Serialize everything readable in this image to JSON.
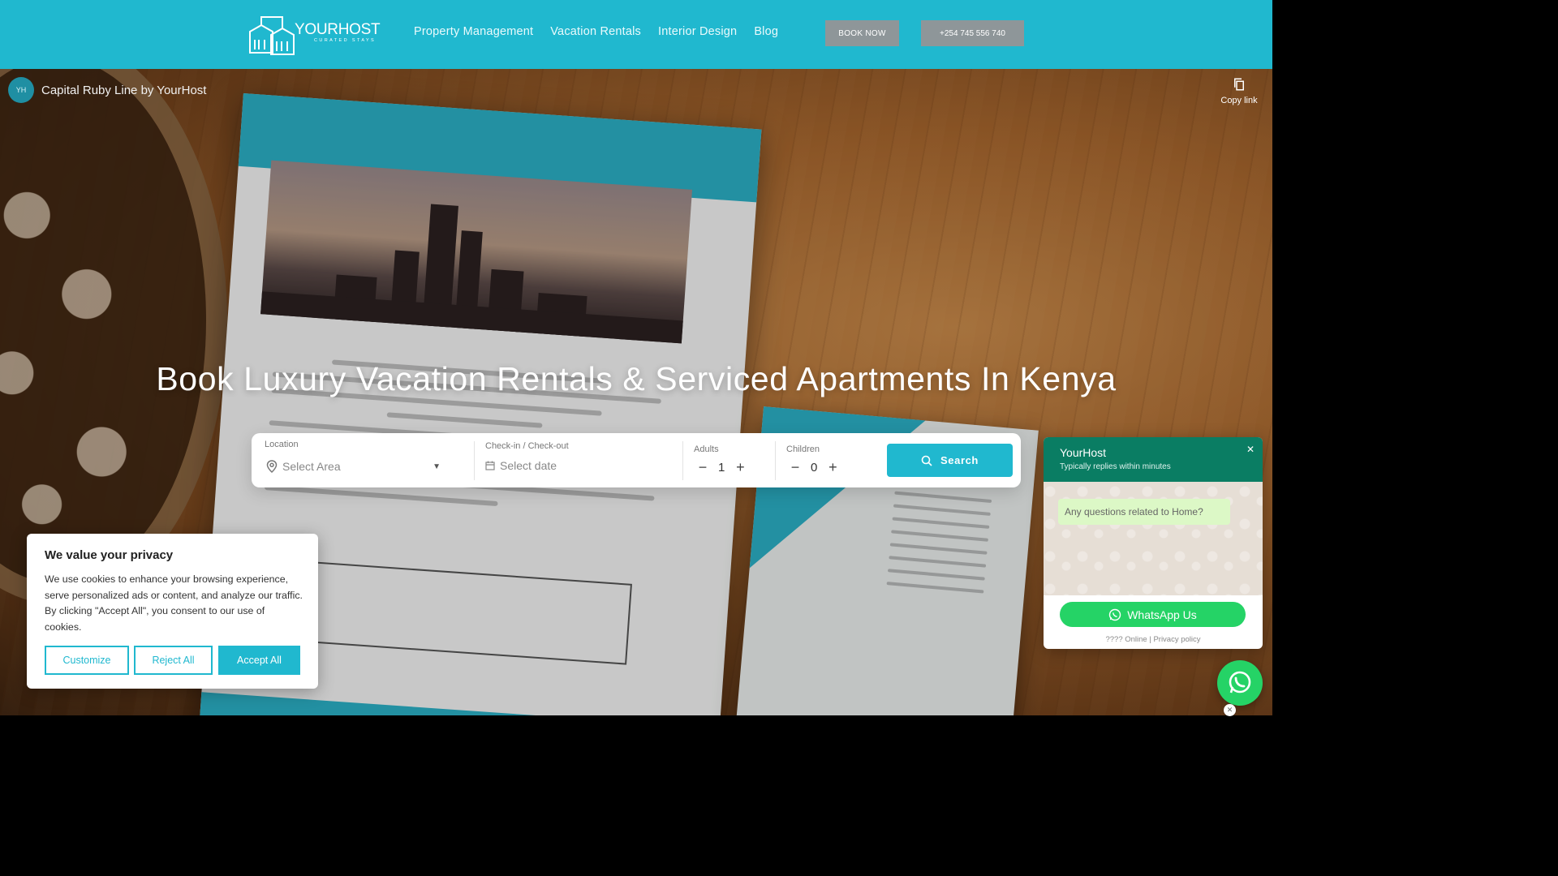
{
  "brand": {
    "name": "YOURHOST",
    "tagline": "CURATED STAYS"
  },
  "nav": {
    "links": [
      "Property Management",
      "Vacation Rentals",
      "Interior Design",
      "Blog"
    ],
    "book_now": "BOOK NOW",
    "phone": "+254 745 556 740"
  },
  "video": {
    "title": "Capital Ruby Line by YourHost",
    "copy_link": "Copy link"
  },
  "hero": {
    "heading": "Book Luxury Vacation Rentals & Serviced Apartments In Kenya"
  },
  "search": {
    "location_label": "Location",
    "location_placeholder": "Select Area",
    "dates_label": "Check-in / Check-out",
    "dates_placeholder": "Select date",
    "adults_label": "Adults",
    "adults_value": "1",
    "children_label": "Children",
    "children_value": "0",
    "button": "Search"
  },
  "cookie": {
    "title": "We value your privacy",
    "text": "We use cookies to enhance your browsing experience, serve personalized ads or content, and analyze our traffic. By clicking \"Accept All\", you consent to our use of cookies.",
    "customize": "Customize",
    "reject": "Reject All",
    "accept": "Accept All"
  },
  "whatsapp": {
    "name": "YourHost",
    "status": "Typically replies within minutes",
    "bubble": "Any questions related to Home?",
    "button": "WhatsApp Us",
    "footer": "???? Online | Privacy policy"
  },
  "colors": {
    "primary": "#20b8cf",
    "whatsapp_green": "#25d366",
    "whatsapp_header": "#0a7d63",
    "nav_button_gray": "#8e9699"
  }
}
